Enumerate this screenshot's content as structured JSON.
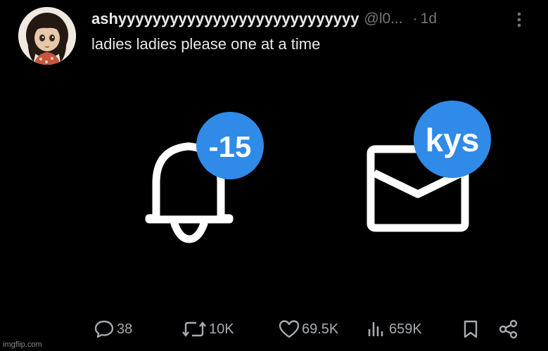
{
  "post": {
    "author_name": "ashyyyyyyyyyyyyyyyyyyyyyyyyyyyy",
    "handle": "@l0...",
    "dot": "·",
    "time": "1d",
    "text": "ladies ladies please one at a time"
  },
  "media": {
    "notifications_badge": "-15",
    "messages_badge": "kys",
    "badge_color": "#2f8ae8",
    "icon_color": "#ffffff"
  },
  "actions": {
    "replies": "38",
    "reposts": "10K",
    "likes": "69.5K",
    "views": "659K"
  },
  "watermark": "imgflip.com"
}
